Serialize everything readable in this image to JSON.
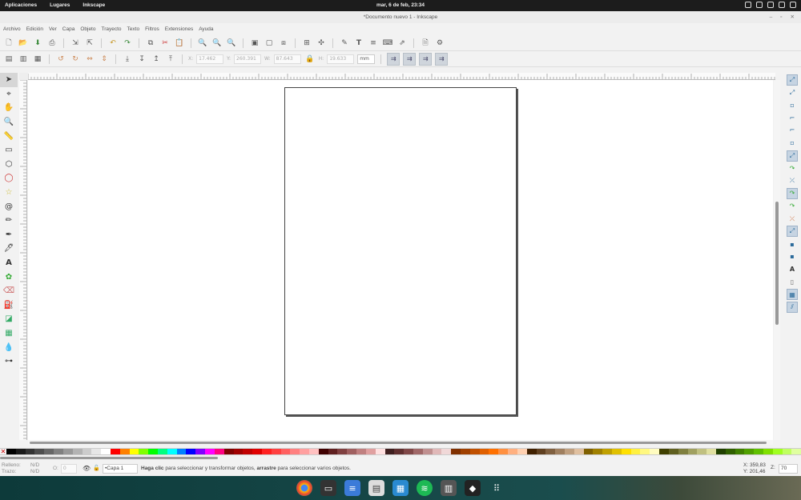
{
  "gnome": {
    "menu_apps": "Aplicaciones",
    "menu_places": "Lugares",
    "menu_app": "Inkscape",
    "clock": "mar, 6 de feb, 23:34",
    "tray_icons": [
      "weather-icon",
      "window-icon",
      "network-icon",
      "volume-icon",
      "power-icon"
    ]
  },
  "window": {
    "title": "*Documento nuevo 1 - Inkscape",
    "controls": {
      "minimize": "–",
      "maximize": "▫",
      "close": "✕"
    }
  },
  "menu": [
    "Archivo",
    "Edición",
    "Ver",
    "Capa",
    "Objeto",
    "Trayecto",
    "Texto",
    "Filtros",
    "Extensiones",
    "Ayuda"
  ],
  "toolbar_icons": [
    "new-doc-icon",
    "open-icon",
    "save-icon",
    "print-icon",
    "import-icon",
    "export-icon",
    "undo-icon",
    "redo-icon",
    "duplicate-icon",
    "cut-icon",
    "paste-icon",
    "zoom-selection-icon",
    "zoom-drawing-icon",
    "zoom-page-icon",
    "group-icon",
    "ungroup-icon",
    "clone-icon",
    "align-icon",
    "nodes-icon",
    "fill-stroke-icon",
    "text-tool-icon",
    "layers-icon",
    "xml-editor-icon",
    "transform-icon",
    "document-properties-icon",
    "preferences-icon"
  ],
  "controls": {
    "x_label": "X:",
    "x_value": "17.462",
    "y_label": "Y:",
    "y_value": "260.391",
    "w_label": "W:",
    "w_value": "87.643",
    "h_label": "H:",
    "h_value": "19.633",
    "unit": "mm"
  },
  "tools": [
    "selector",
    "node",
    "tweak",
    "zoom",
    "measure",
    "rect",
    "3dbox",
    "ellipse",
    "star",
    "spiral",
    "pencil",
    "pen",
    "calligraphy",
    "text",
    "spray",
    "eraser",
    "paint-bucket",
    "gradient",
    "mesh",
    "dropper",
    "connector"
  ],
  "snap_icons": [
    "snap-enable",
    "snap-bbox",
    "snap-bbox-edge",
    "snap-bbox-corner",
    "snap-bbox-midpoint",
    "snap-bbox-center",
    "snap-nodes",
    "snap-path",
    "snap-intersection",
    "snap-cusp",
    "snap-smooth",
    "snap-line-midpoint",
    "snap-others",
    "snap-object-center",
    "snap-rotation-center",
    "snap-text-baseline",
    "snap-page",
    "snap-grid",
    "snap-guide"
  ],
  "palette": [
    "#000000",
    "#1a1a1a",
    "#333333",
    "#4d4d4d",
    "#666666",
    "#808080",
    "#999999",
    "#b3b3b3",
    "#cccccc",
    "#e6e6e6",
    "#ffffff",
    "#ff0000",
    "#ff8000",
    "#ffff00",
    "#80ff00",
    "#00ff00",
    "#00ff80",
    "#00ffff",
    "#0080ff",
    "#0000ff",
    "#8000ff",
    "#ff00ff",
    "#ff0080",
    "#800000",
    "#a00000",
    "#c00000",
    "#e00000",
    "#ff2020",
    "#ff4040",
    "#ff6060",
    "#ff8080",
    "#ffa0a0",
    "#ffc0c0",
    "#400000",
    "#602020",
    "#804040",
    "#a06060",
    "#c08080",
    "#e0a0a0",
    "#ffe0e0",
    "#402020",
    "#603030",
    "#804848",
    "#a06868",
    "#c09090",
    "#e0b8b8",
    "#f0d8d8",
    "#803000",
    "#a04000",
    "#c05000",
    "#e06000",
    "#ff7000",
    "#ff9040",
    "#ffb080",
    "#ffd0b0",
    "#402000",
    "#604020",
    "#806040",
    "#a08060",
    "#c0a080",
    "#e0c0a0",
    "#806000",
    "#a08000",
    "#c0a000",
    "#e0c000",
    "#ffe000",
    "#fff040",
    "#fff880",
    "#fffcc0",
    "#404000",
    "#606020",
    "#808040",
    "#a0a060",
    "#c0c080",
    "#e0e0a0",
    "#204000",
    "#306000",
    "#408000",
    "#50a000",
    "#60c000",
    "#80e000",
    "#a0ff20",
    "#c0ff60",
    "#e0ffa0"
  ],
  "status": {
    "fill_label": "Relleno:",
    "fill_value": "N/D",
    "stroke_label": "Trazo:",
    "stroke_value": "N/D",
    "opacity_label": "O:",
    "opacity_value": "0",
    "layer": "•Capa 1",
    "msg_b1": "Haga clic",
    "msg_1": " para seleccionar y transformar objetos, ",
    "msg_b2": "arrastre",
    "msg_2": " para seleccionar varios objetos.",
    "x": "X: 359,83",
    "y": "Y: 201,46",
    "zoom_label": "Z:",
    "zoom_value": "70"
  },
  "dock_apps": [
    "chrome-icon",
    "terminal-icon",
    "docs-icon",
    "files-icon",
    "store-icon",
    "spotify-icon",
    "library-icon",
    "inkscape-icon",
    "app-grid-icon"
  ]
}
